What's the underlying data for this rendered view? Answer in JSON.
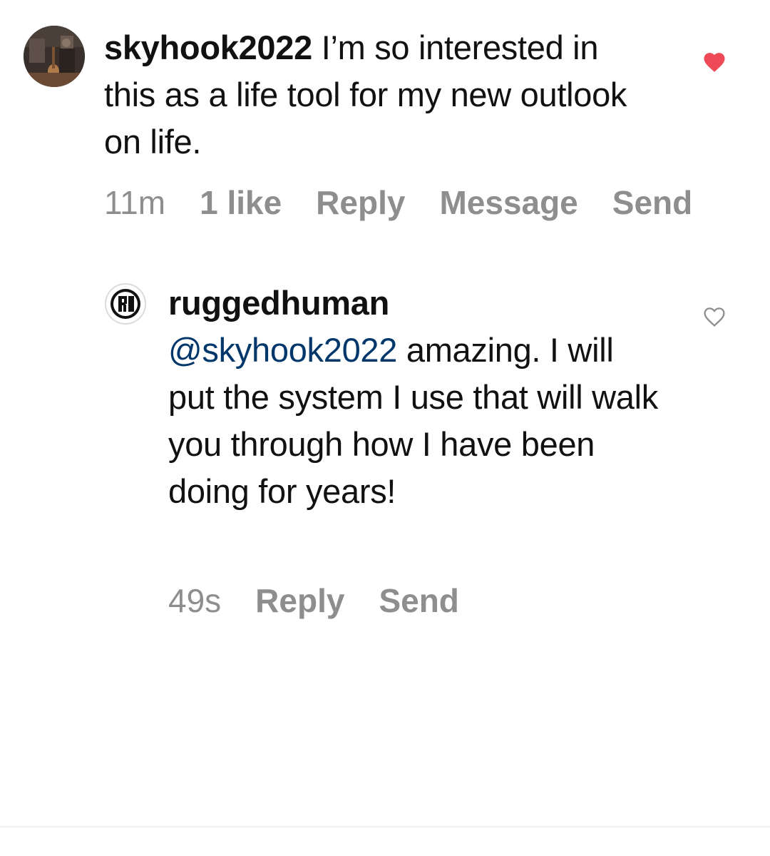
{
  "comments": [
    {
      "username": "skyhook2022",
      "text": " I’m so interested in this as a life tool for my new outlook on life.",
      "time": "11m",
      "likes": "1 like",
      "reply_label": "Reply",
      "message_label": "Message",
      "send_label": "Send",
      "liked": true,
      "like_color": "#ed4956",
      "avatar_icon": "guitar-photo-avatar"
    },
    {
      "username": "ruggedhuman",
      "mention": "@skyhook2022",
      "text": " amazing. I will put the system I use that will walk you through how I have been doing for years!",
      "time": "49s",
      "reply_label": "Reply",
      "send_label": "Send",
      "liked": false,
      "avatar_logo_text": "RH",
      "mention_color": "#00376b"
    }
  ],
  "colors": {
    "text": "#111111",
    "meta": "#8e8e8e",
    "background": "#ffffff"
  }
}
